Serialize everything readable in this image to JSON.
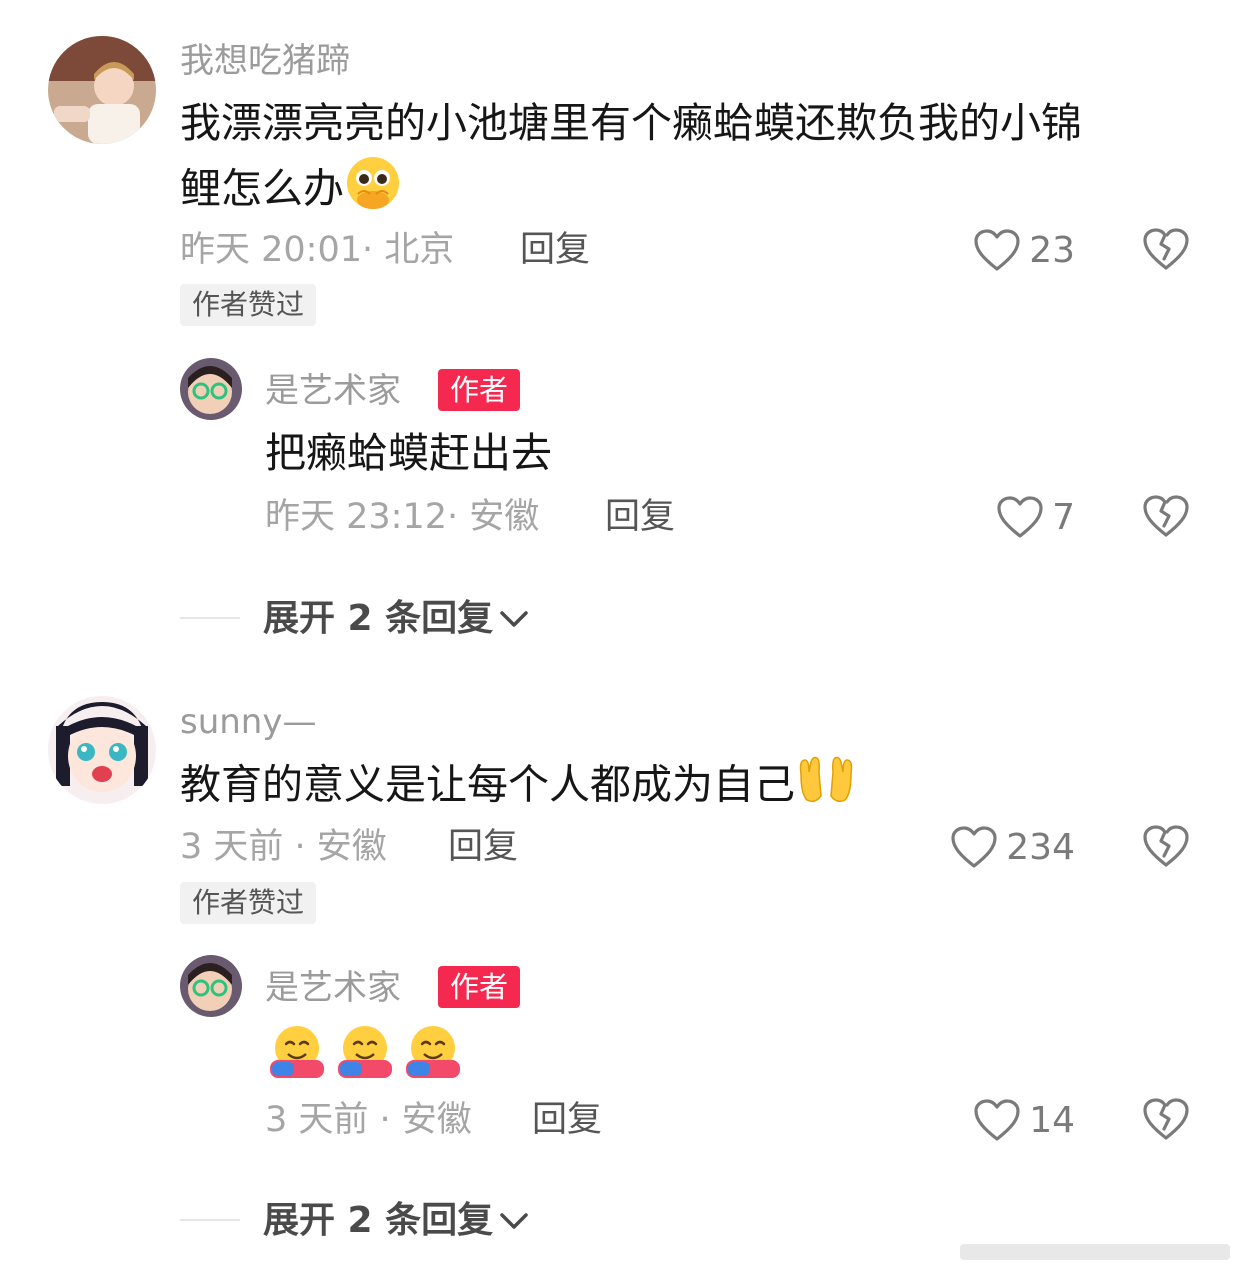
{
  "comments": [
    {
      "username": "我想吃猪蹄",
      "text_line1": "我漂漂亮亮的小池塘里有个癞蛤蟆还欺负我的小锦",
      "text_line2": "鲤怎么办",
      "emoji": "pleading-face-with-hands",
      "meta": "昨天 20:01· 北京",
      "reply_label": "回复",
      "likes": "23",
      "badge": "作者赞过",
      "reply": {
        "username": "是艺术家",
        "author_badge": "作者",
        "text": "把癞蛤蟆赶出去",
        "meta": "昨天 23:12· 安徽",
        "reply_label": "回复",
        "likes": "7"
      },
      "expand_label": "展开 2 条回复"
    },
    {
      "username": "sunny—",
      "text": "教育的意义是让每个人都成为自己",
      "emoji": "palms-up-together",
      "meta": "3 天前 · 安徽",
      "reply_label": "回复",
      "likes": "234",
      "badge": "作者赞过",
      "reply": {
        "username": "是艺术家",
        "author_badge": "作者",
        "emojis": [
          "hugging-face",
          "hugging-face",
          "hugging-face"
        ],
        "meta": "3 天前 · 安徽",
        "reply_label": "回复",
        "likes": "14"
      },
      "expand_label": "展开 2 条回复"
    }
  ],
  "colors": {
    "author_badge": "#f5294f",
    "username": "#9b9b9b",
    "text": "#161616"
  }
}
